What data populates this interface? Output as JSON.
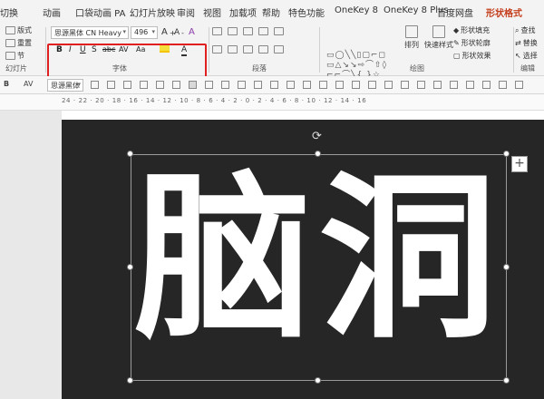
{
  "tabs": [
    "切换",
    "动画",
    "口袋动画 PA",
    "幻灯片放映",
    "审阅",
    "视图",
    "加载项",
    "帮助",
    "特色功能",
    "OneKey 8",
    "OneKey 8 Plus",
    "百度网盘",
    "形状格式"
  ],
  "ribbon": {
    "slides": {
      "layout": "版式",
      "reset": "重置",
      "section": "节",
      "label": "幻灯片"
    },
    "font": {
      "family": "思源黑体 CN Heavy",
      "size": "496",
      "grow": "A",
      "shrink": "A",
      "clear": "A",
      "bold": "B",
      "italic": "I",
      "underline": "U",
      "shadow": "S",
      "strike": "abc",
      "spacing": "AV",
      "case": "Aa",
      "color": "A",
      "label": "字体"
    },
    "paragraph": {
      "label": "段落"
    },
    "drawing": {
      "arrange": "排列",
      "quick_styles": "快速样式",
      "fill": "形状填充",
      "outline": "形状轮廓",
      "effects": "形状效果",
      "label": "绘图"
    },
    "editing": {
      "find": "查找",
      "replace": "替换",
      "select": "选择",
      "label": "编辑"
    }
  },
  "minibar": {
    "font": "思源黑体"
  },
  "ruler": {
    "numbers": "24 · 22 · 20 · 18 · 16 · 14 · 12 · 10 · 8 · 6 · 4 · 2 · 0 · 2 · 4 · 6 · 8 · 10 · 12 · 14 · 16"
  },
  "slide": {
    "text": "脑洞",
    "plus": "+"
  },
  "colors": {
    "highlight": "#e02020",
    "slide_bg": "#262626",
    "active_tab": "#c43e1c"
  }
}
